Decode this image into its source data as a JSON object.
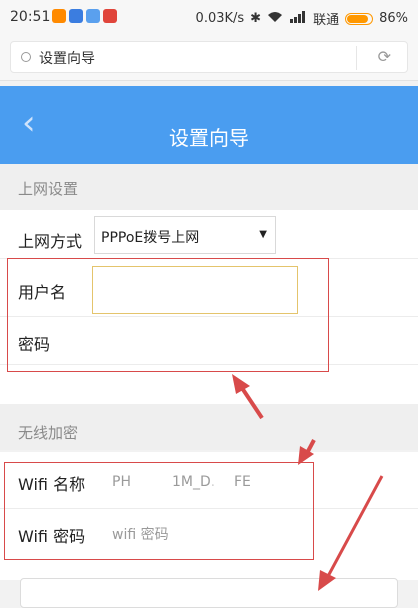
{
  "status_bar": {
    "time": "20:51",
    "speed": "0.03K/s",
    "carrier": "联通",
    "battery": "86%",
    "icons": [
      "bluetooth-icon",
      "wifi-icon",
      "signal-icon"
    ]
  },
  "browser": {
    "page_title": "设置向导"
  },
  "header": {
    "title": "设置向导",
    "back_icon": "chevron-left-icon"
  },
  "internet": {
    "section_title": "上网设置",
    "method_label": "上网方式",
    "method_value": "PPPoE拨号上网",
    "username_label": "用户名",
    "username_value": "",
    "password_label": "密码"
  },
  "wireless": {
    "section_title": "无线加密",
    "ssid_label": "Wifi 名称",
    "ssid_value_part1": "PH",
    "ssid_value_part2": "1M_D.",
    "ssid_value_part3": "FE",
    "password_label": "Wifi 密码",
    "password_placeholder": "wifi 密码"
  },
  "colors": {
    "header_blue": "#4a9df0",
    "annotation_red": "#d84a4a",
    "input_focus": "#e4c46c",
    "battery": "#ff9800"
  }
}
